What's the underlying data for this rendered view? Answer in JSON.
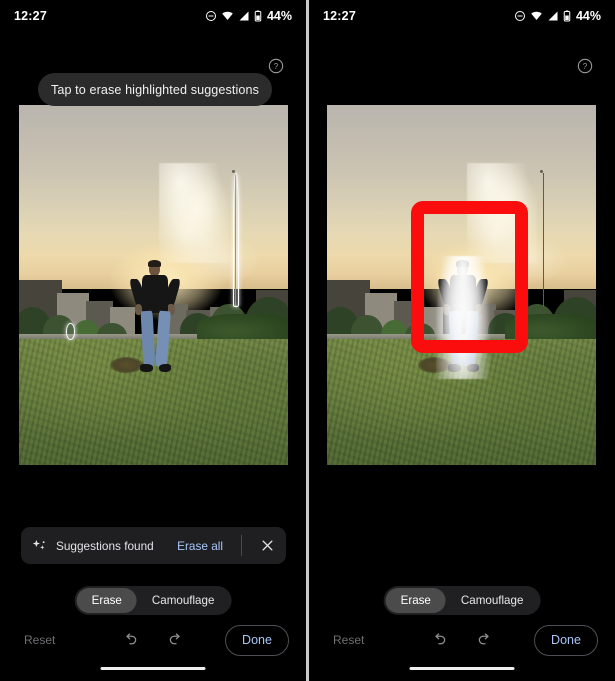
{
  "meta": {
    "app": "Google Photos Magic Eraser",
    "accent_blue": "#a8c7fa",
    "annotation_red": "#fb0d0d",
    "surface_dark": "#1f1f22",
    "background": "#000000"
  },
  "left_panel": {
    "status_bar": {
      "clock": "12:27",
      "battery_percent": "44%",
      "icons": [
        "do-not-disturb-icon",
        "wifi-icon",
        "signal-icon",
        "battery-icon"
      ]
    },
    "help_icon": "help-circle-icon",
    "tooltip": {
      "text": "Tap to erase highlighted suggestions"
    },
    "photo": {
      "description": "Person standing in a grassy field at sunset with buildings and trees behind",
      "highlights": [
        "tower-suggestion-outline",
        "small-object-suggestion-outline"
      ]
    },
    "suggestions_bar": {
      "icon": "sparkle-icon",
      "label": "Suggestions found",
      "erase_all_label": "Erase all",
      "close_icon": "close-icon"
    },
    "mode_toggle": {
      "options": [
        {
          "label": "Erase",
          "selected": true
        },
        {
          "label": "Camouflage",
          "selected": false
        }
      ]
    },
    "bottom_bar": {
      "reset_label": "Reset",
      "undo_icon": "undo-icon",
      "redo_icon": "redo-icon",
      "done_label": "Done"
    }
  },
  "right_panel": {
    "status_bar": {
      "clock": "12:27",
      "battery_percent": "44%",
      "icons": [
        "do-not-disturb-icon",
        "wifi-icon",
        "signal-icon",
        "battery-icon"
      ]
    },
    "help_icon": "help-circle-icon",
    "photo": {
      "description": "Same scene with the person selected and highlighted white, marked by a red rectangle annotation",
      "annotation": "red-rectangle-highlight"
    },
    "mode_toggle": {
      "options": [
        {
          "label": "Erase",
          "selected": true
        },
        {
          "label": "Camouflage",
          "selected": false
        }
      ]
    },
    "bottom_bar": {
      "reset_label": "Reset",
      "undo_icon": "undo-icon",
      "redo_icon": "redo-icon",
      "done_label": "Done"
    }
  }
}
